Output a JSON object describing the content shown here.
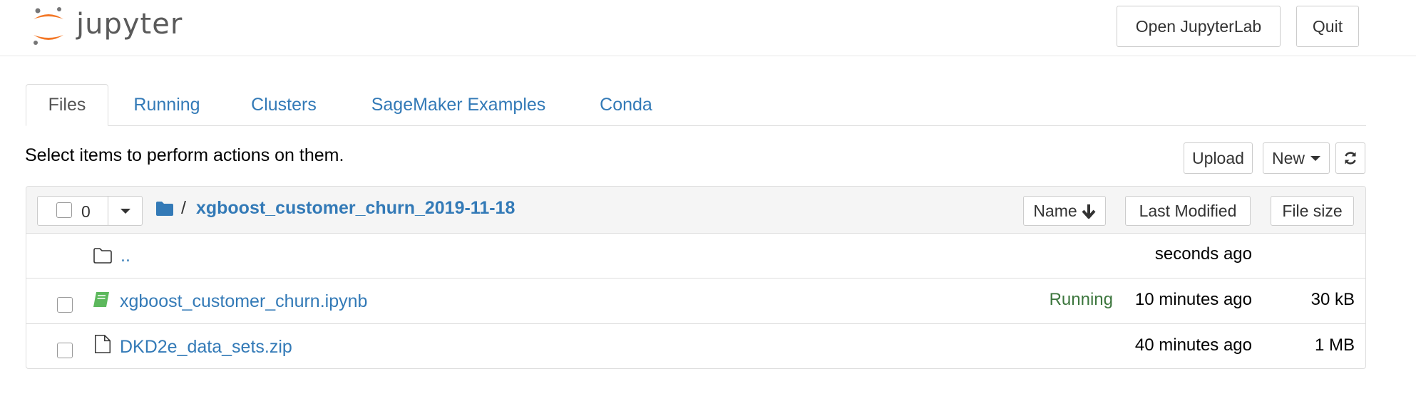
{
  "header": {
    "logo_text": "jupyter",
    "open_jupyterlab": "Open JupyterLab",
    "quit": "Quit"
  },
  "tabs": [
    {
      "label": "Files",
      "active": true
    },
    {
      "label": "Running",
      "active": false
    },
    {
      "label": "Clusters",
      "active": false
    },
    {
      "label": "SageMaker Examples",
      "active": false
    },
    {
      "label": "Conda",
      "active": false
    }
  ],
  "toolbar": {
    "notice": "Select items to perform actions on them.",
    "upload": "Upload",
    "new": "New"
  },
  "list_header": {
    "selected_count": "0",
    "slash": "/",
    "current_dir": "xgboost_customer_churn_2019-11-18",
    "sort_name": "Name",
    "sort_last_modified": "Last Modified",
    "sort_file_size": "File size"
  },
  "rows": [
    {
      "name": "..",
      "icon": "folder-outline-icon",
      "status": "",
      "modified": "seconds ago",
      "size": ""
    },
    {
      "name": "xgboost_customer_churn.ipynb",
      "icon": "notebook-icon",
      "status": "Running",
      "modified": "10 minutes ago",
      "size": "30 kB"
    },
    {
      "name": "DKD2e_data_sets.zip",
      "icon": "file-icon",
      "status": "",
      "modified": "40 minutes ago",
      "size": "1 MB"
    }
  ],
  "colors": {
    "link": "#337ab7",
    "running": "#3c763d",
    "logo_orange": "#f37726",
    "notebook_green": "#5cb85c"
  }
}
